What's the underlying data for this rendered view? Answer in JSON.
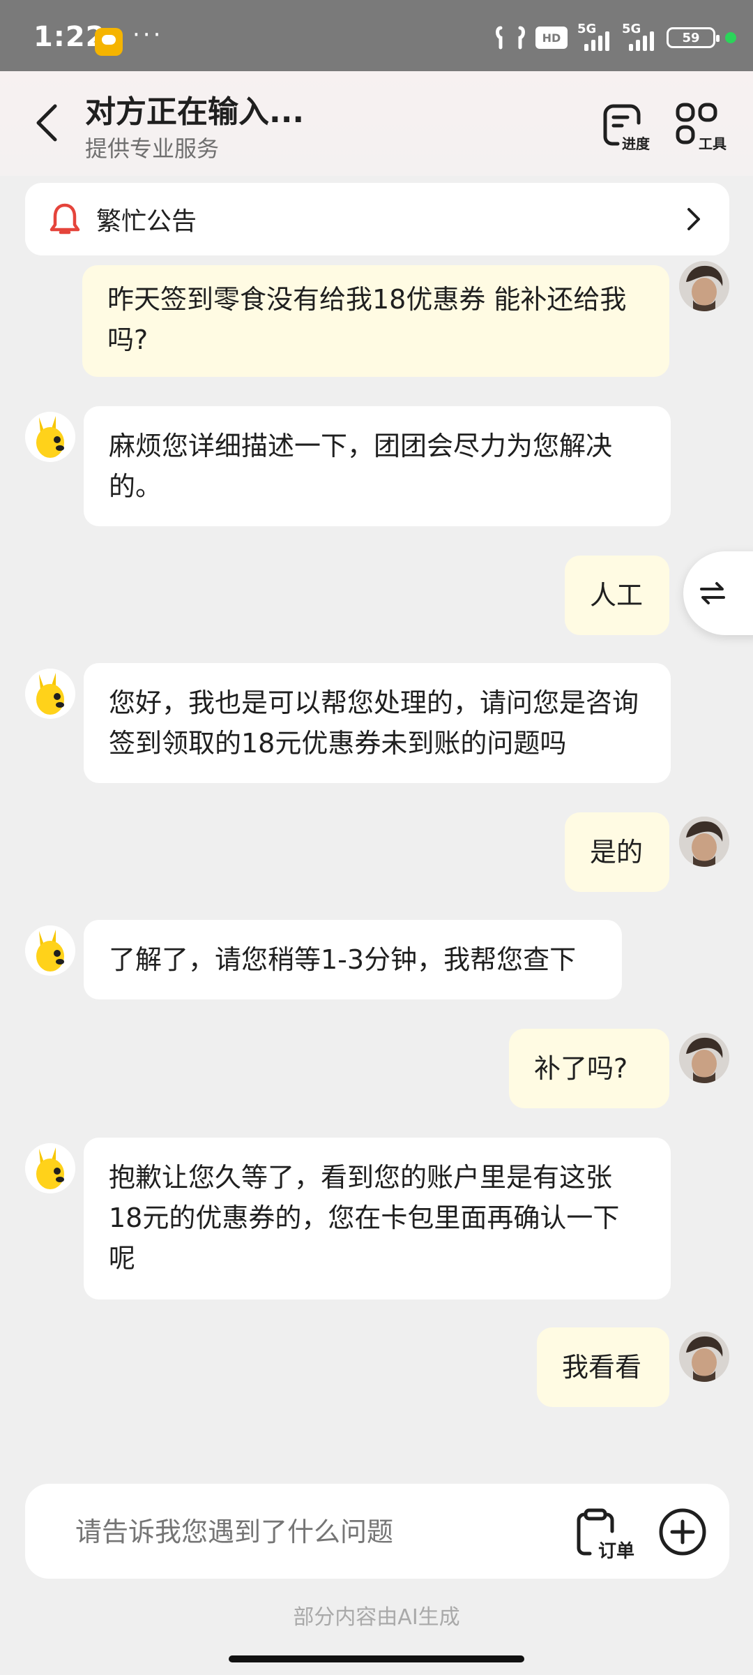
{
  "status_bar": {
    "time": "1:22",
    "more": "···",
    "hd_label": "HD",
    "signal_1_label": "5G",
    "signal_2_label": "5G",
    "battery": "59",
    "app_icon": "meituan-app-icon"
  },
  "header": {
    "title": "对方正在输入...",
    "subtitle": "提供专业服务",
    "progress_label": "进度",
    "tools_label": "工具"
  },
  "notice": {
    "text": "繁忙公告"
  },
  "messages": [
    {
      "sender": "user",
      "text": "昨天签到零食没有给我18优惠券 能补还给我吗?"
    },
    {
      "sender": "agent",
      "text": "麻烦您详细描述一下，团团会尽力为您解决的。"
    },
    {
      "sender": "user",
      "text": "人工"
    },
    {
      "sender": "agent",
      "text": "您好，我也是可以帮您处理的，请问您是咨询签到领取的18元优惠券未到账的问题吗"
    },
    {
      "sender": "user",
      "text": "是的"
    },
    {
      "sender": "agent",
      "text": "了解了，请您稍等1-3分钟，我帮您查下"
    },
    {
      "sender": "user",
      "text": "补了吗?"
    },
    {
      "sender": "agent",
      "text": "抱歉让您久等了，看到您的账户里是有这张18元的优惠券的，您在卡包里面再确认一下呢"
    },
    {
      "sender": "user",
      "text": "我看看"
    }
  ],
  "input": {
    "placeholder": "请告诉我您遇到了什么问题",
    "order_label": "订单"
  },
  "footer": {
    "ai_note": "部分内容由AI生成"
  },
  "colors": {
    "user_bubble": "#fffbe3",
    "agent_bubble": "#ffffff",
    "bell": "#e5443b",
    "status_bar": "#7a7a7a"
  }
}
